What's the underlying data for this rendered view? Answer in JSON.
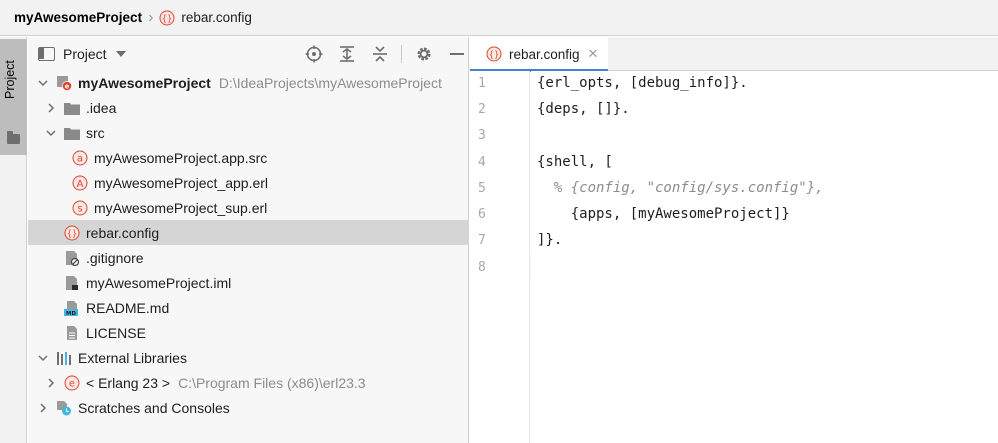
{
  "navbar": {
    "project": "myAwesomeProject",
    "file": "rebar.config"
  },
  "stripe": {
    "label": "Project"
  },
  "panel": {
    "title": "Project",
    "tools": [
      "locate-icon",
      "expand-all-icon",
      "collapse-all-icon",
      "gear-icon",
      "minimize-icon"
    ]
  },
  "tree": [
    {
      "name": "myAwesomeProject",
      "path": "D:\\IdeaProjects\\myAwesomeProject",
      "icon": "erlang-module-icon",
      "expanded": true,
      "bold": true
    },
    {
      "name": ".idea",
      "icon": "folder-icon",
      "expanded": false
    },
    {
      "name": "src",
      "icon": "folder-icon",
      "expanded": true
    },
    {
      "name": "myAwesomeProject.app.src",
      "icon": "app-src-icon",
      "glyph": "a"
    },
    {
      "name": "myAwesomeProject_app.erl",
      "icon": "application-icon",
      "glyph": "A"
    },
    {
      "name": "myAwesomeProject_sup.erl",
      "icon": "supervisor-icon",
      "glyph": "s"
    },
    {
      "name": "rebar.config",
      "icon": "config-icon",
      "glyph": "{}",
      "selected": true
    },
    {
      "name": ".gitignore",
      "icon": "ignore-file-icon"
    },
    {
      "name": "myAwesomeProject.iml",
      "icon": "iml-file-icon"
    },
    {
      "name": "README.md",
      "icon": "markdown-icon"
    },
    {
      "name": "LICENSE",
      "icon": "text-file-icon"
    },
    {
      "name": "External Libraries",
      "icon": "libraries-icon",
      "expanded": true
    },
    {
      "name": "< Erlang 23 >",
      "path": "C:\\Program Files (x86)\\erl23.3",
      "icon": "erlang-sdk-icon",
      "glyph": "e",
      "expanded": false
    },
    {
      "name": "Scratches and Consoles",
      "icon": "scratches-icon",
      "expanded": false
    }
  ],
  "editor": {
    "tab_label": "rebar.config",
    "line_numbers": [
      "1",
      "2",
      "3",
      "4",
      "5",
      "6",
      "7",
      "8"
    ],
    "lines": [
      "{erl_opts, [debug_info]}.",
      "{deps, []}.",
      "",
      "{shell, [",
      "  % {config, \"config/sys.config\"},",
      "    {apps, [myAwesomeProject]}",
      "]}.",
      ""
    ]
  },
  "colors": {
    "accent": "#4083c9",
    "erlang_red": "#d9452f",
    "selection": "#d5d5d5"
  }
}
